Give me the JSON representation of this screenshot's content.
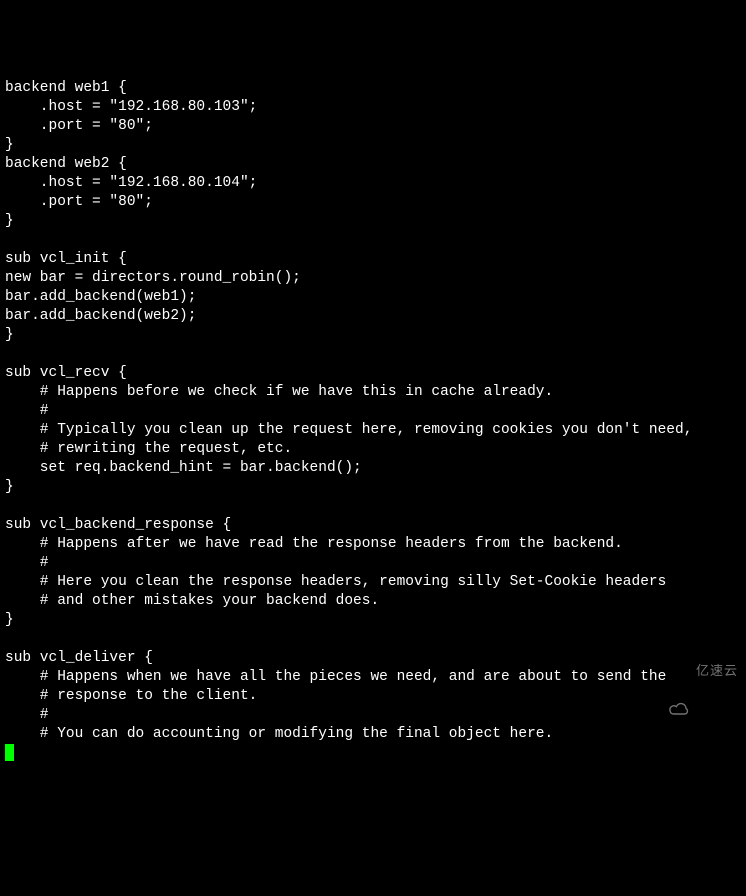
{
  "code": {
    "lines": [
      "backend web1 {",
      "    .host = \"192.168.80.103\";",
      "    .port = \"80\";",
      "}",
      "backend web2 {",
      "    .host = \"192.168.80.104\";",
      "    .port = \"80\";",
      "}",
      "",
      "sub vcl_init {",
      "new bar = directors.round_robin();",
      "bar.add_backend(web1);",
      "bar.add_backend(web2);",
      "}",
      "",
      "sub vcl_recv {",
      "    # Happens before we check if we have this in cache already.",
      "    #",
      "    # Typically you clean up the request here, removing cookies you don't need,",
      "    # rewriting the request, etc.",
      "    set req.backend_hint = bar.backend();",
      "}",
      "",
      "sub vcl_backend_response {",
      "    # Happens after we have read the response headers from the backend.",
      "    #",
      "    # Here you clean the response headers, removing silly Set-Cookie headers",
      "    # and other mistakes your backend does.",
      "}",
      "",
      "sub vcl_deliver {",
      "    # Happens when we have all the pieces we need, and are about to send the",
      "    # response to the client.",
      "    #",
      "    # You can do accounting or modifying the final object here."
    ]
  },
  "watermark": {
    "text": "亿速云"
  }
}
